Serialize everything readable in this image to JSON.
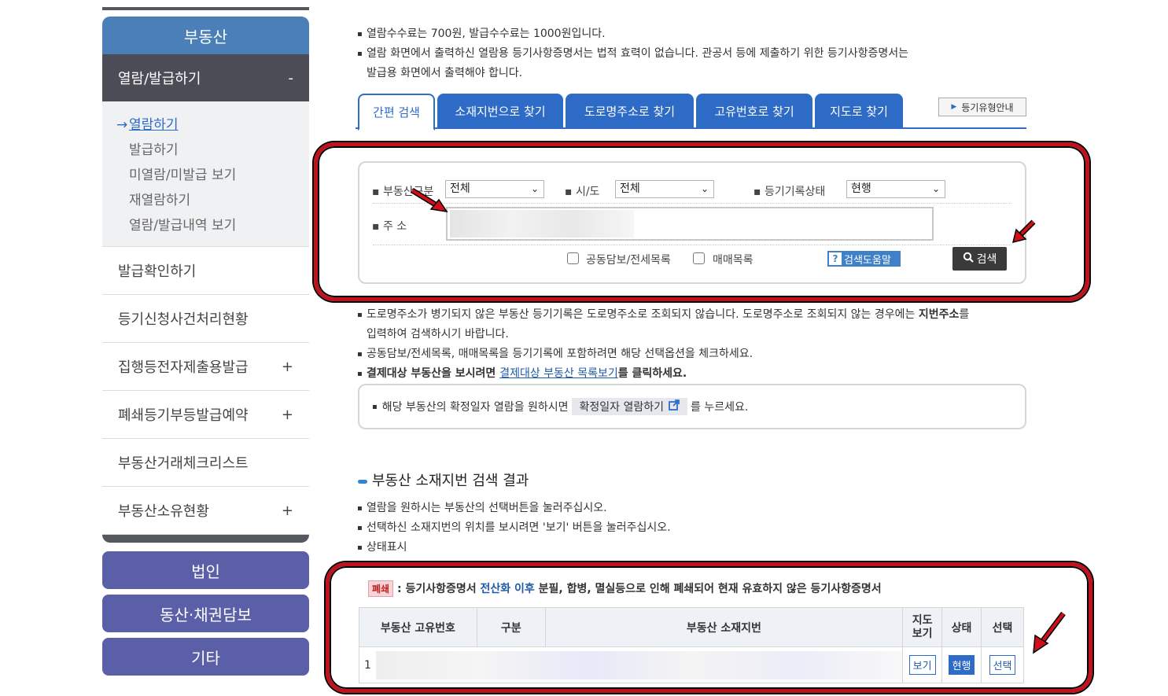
{
  "sidebar": {
    "head": "부동산",
    "sub": {
      "label": "열람/발급하기",
      "toggle": "-"
    },
    "subitems": [
      {
        "label": "열람하기",
        "active": true
      },
      {
        "label": "발급하기"
      },
      {
        "label": "미열람/미발급 보기"
      },
      {
        "label": "재열람하기"
      },
      {
        "label": "열람/발급내역 보기"
      }
    ],
    "items": [
      {
        "label": "발급확인하기",
        "toggle": ""
      },
      {
        "label": "등기신청사건처리현황",
        "toggle": ""
      },
      {
        "label": "집행등전자제출용발급",
        "toggle": "+"
      },
      {
        "label": "폐쇄등기부등발급예약",
        "toggle": "+"
      },
      {
        "label": "부동산거래체크리스트",
        "toggle": ""
      },
      {
        "label": "부동산소유현황",
        "toggle": "+"
      }
    ],
    "buttons": [
      "법인",
      "동산·채권담보",
      "기타"
    ]
  },
  "top_notes": [
    "열람수수료는 700원, 발급수수료는 1000원입니다.",
    "열람 화면에서 출력하신 열람용 등기사항증명서는 법적 효력이 없습니다. 관공서 등에 제출하기 위한 등기사항증명서는",
    "발급용 화면에서 출력해야 합니다."
  ],
  "tabs": [
    "간편 검색",
    "소재지번으로 찾기",
    "도로명주소로 찾기",
    "고유번호로 찾기",
    "지도로 찾기"
  ],
  "guide_button": "등기유형안내",
  "search": {
    "type_label": "부동산구분",
    "type_value": "전체",
    "sido_label": "시/도",
    "sido_value": "전체",
    "status_label": "등기기록상태",
    "status_value": "현행",
    "address_label": "주 소",
    "check1": "공동담보/전세목록",
    "check2": "매매목록",
    "help": "검색도움말",
    "help_q": "?",
    "search_button": "검색"
  },
  "mid_notes": {
    "n1a": "도로명주소가 병기되지 않은 부동산 등기기록은 도로명주소로 조회되지 않습니다. 도로명주소로 조회되지 않는 경우에는 ",
    "n1b": "지번주소",
    "n1c": "를",
    "n1d": "입력하여 검색하시기 바랍니다.",
    "n2": "공동담보/전세목록, 매매목록을 등기기록에 포함하려면 해당 선택옵션을 체크하세요.",
    "n3a": "결제대상 부동산을 보시려면 ",
    "n3link": "결제대상 부동산 목록보기",
    "n3b": "를 클릭하세요."
  },
  "date_note": {
    "pre": "해당 부동산의 확정일자 열람을 원하시면",
    "button": "확정일자 열람하기",
    "post": "를 누르세요."
  },
  "results": {
    "title": "부동산 소재지번 검색 결과",
    "notes": [
      "열람을 원하시는 부동산의 선택버튼을 눌러주십시오.",
      "선택하신 소재지번의 위치를 보시려면 '보기' 버튼을 눌러주십시오.",
      "상태표시"
    ],
    "legend_closed_badge": "폐쇄",
    "legend_closed_a": " : 등기사항증명서 ",
    "legend_closed_b": "전산화 이후",
    "legend_closed_c": " 분필, 합병, 멸실등으로 인해 폐쇄되어 현재 유효하지 않은 등기사항증명서",
    "columns": [
      "부동산 고유번호",
      "구분",
      "부동산 소재지번",
      "지도\n보기",
      "상태",
      "선택"
    ],
    "row": {
      "index": "1",
      "view": "보기",
      "status": "현행",
      "select": "선택"
    }
  }
}
